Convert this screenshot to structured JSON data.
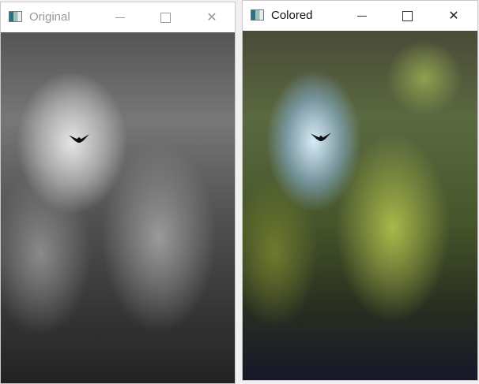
{
  "windows": [
    {
      "title": "Original",
      "active": false,
      "image": "grayscale tree canopy photo"
    },
    {
      "title": "Colored",
      "active": true,
      "image": "colorized tree canopy photo"
    }
  ],
  "controls": {
    "minimize": "minimize-icon",
    "maximize": "maximize-icon",
    "close": "close-icon"
  }
}
